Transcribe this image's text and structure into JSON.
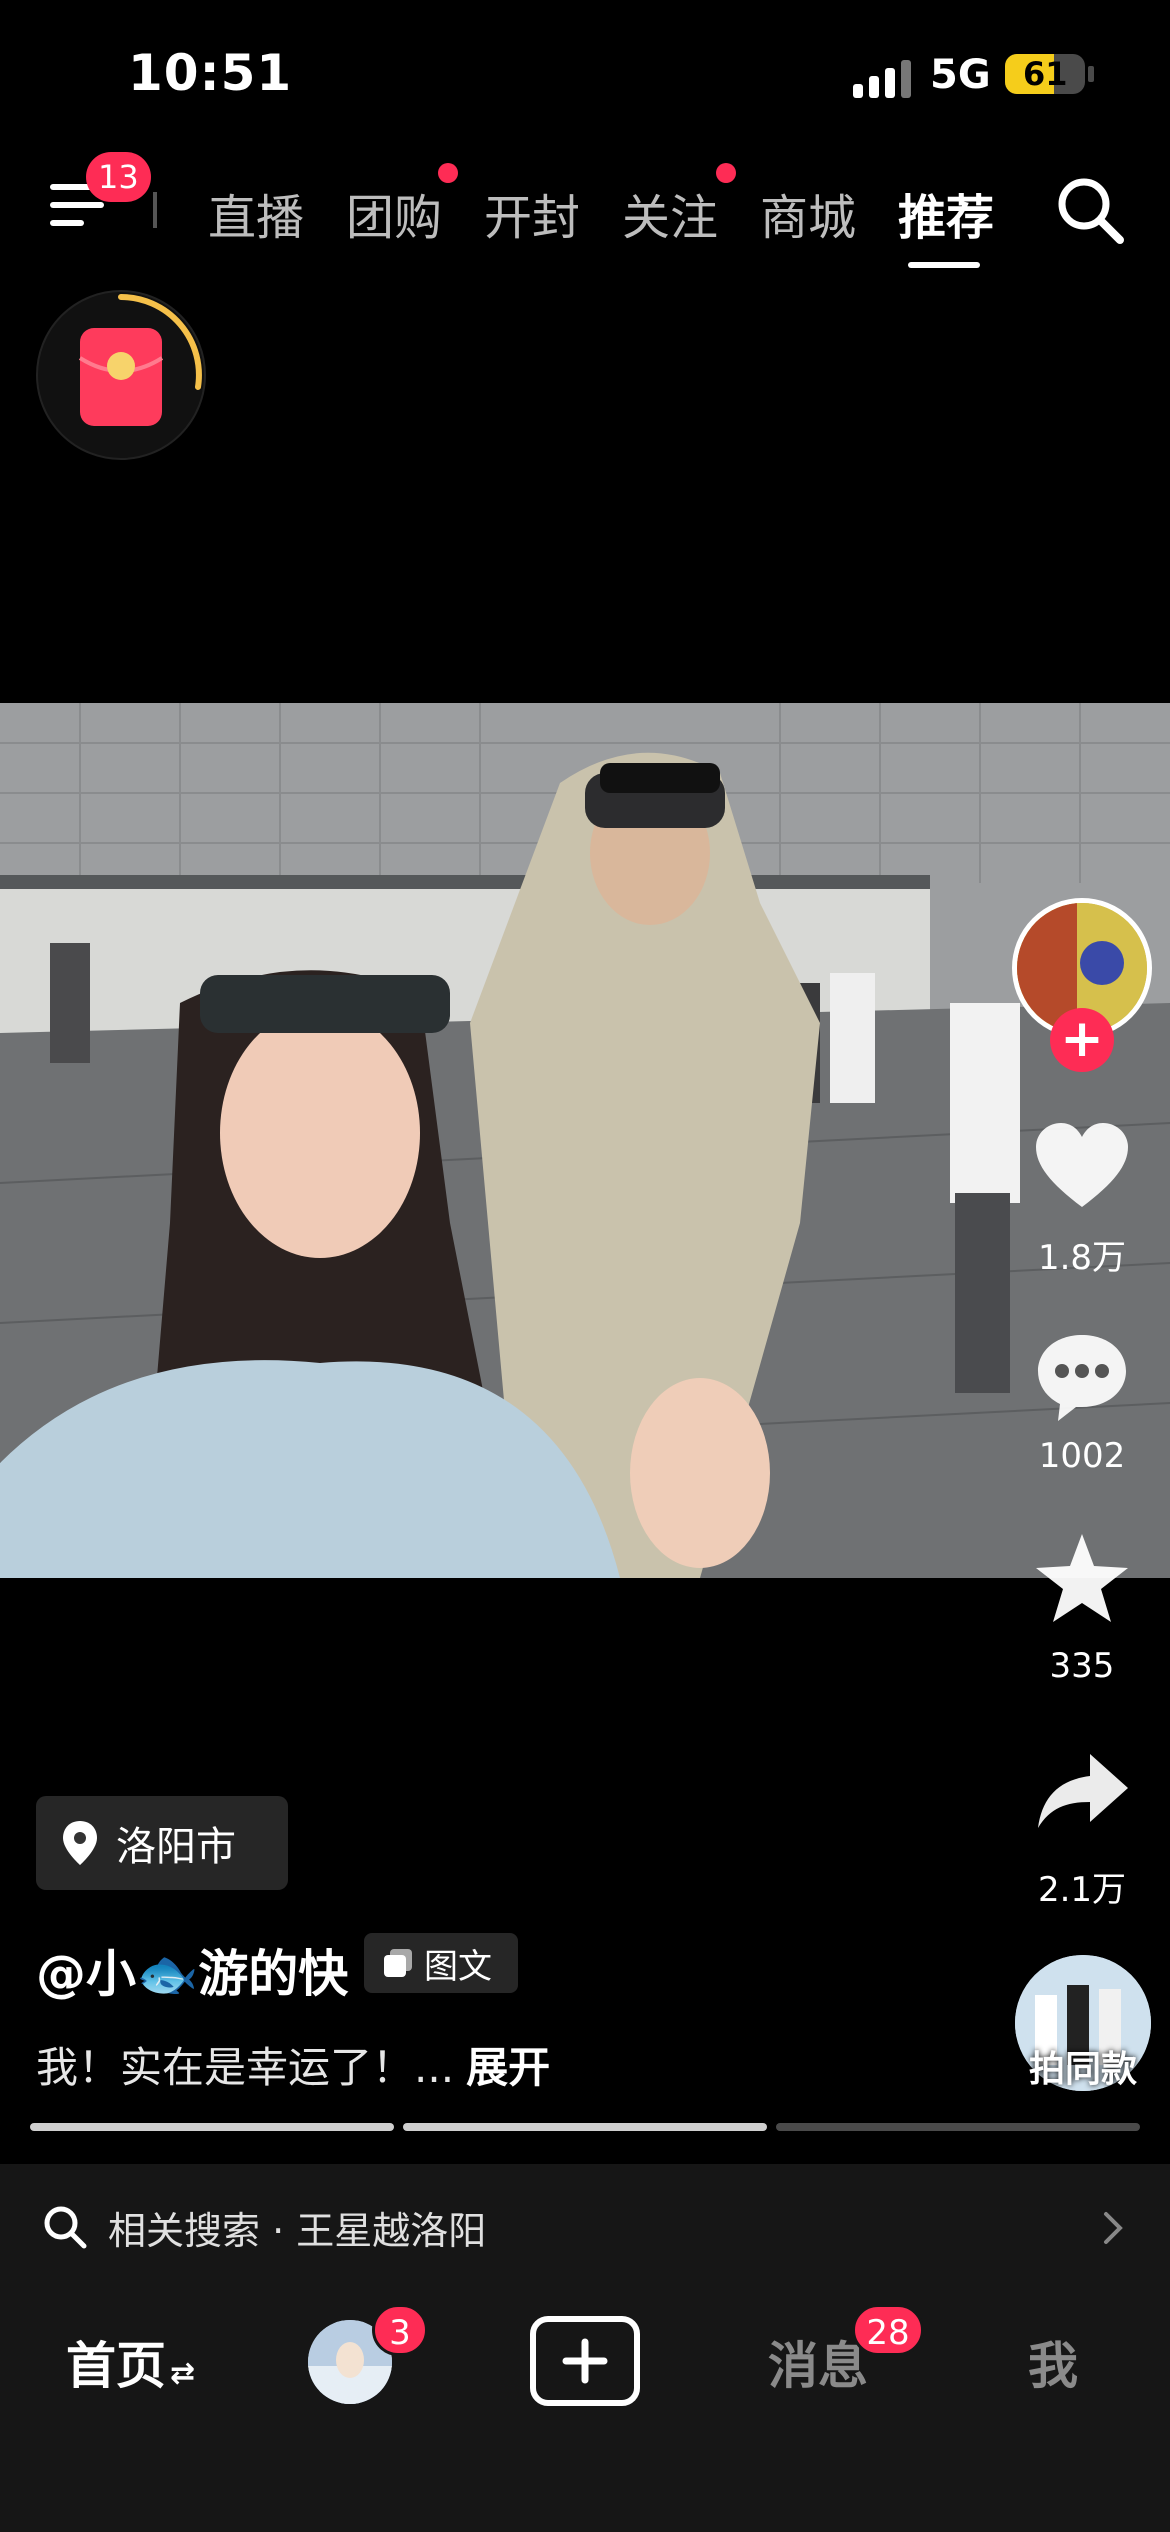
{
  "status_bar": {
    "time": "10:51",
    "network": "5G",
    "battery": "61",
    "battery_level": 0.61
  },
  "top_nav": {
    "menu_badge": "13",
    "tabs": [
      {
        "label": "直播",
        "has_dot": false,
        "active": false
      },
      {
        "label": "团购",
        "has_dot": true,
        "active": false
      },
      {
        "label": "开封",
        "has_dot": false,
        "active": false
      },
      {
        "label": "关注",
        "has_dot": true,
        "active": false
      },
      {
        "label": "商城",
        "has_dot": false,
        "active": false
      },
      {
        "label": "推荐",
        "has_dot": false,
        "active": true
      }
    ]
  },
  "rail": {
    "likes": "1.8万",
    "comments": "1002",
    "favorites": "335",
    "shares": "2.1万",
    "same_style_label": "拍同款"
  },
  "post": {
    "location": "洛阳市",
    "author": "@小🐟游的快",
    "type_tag": "图文",
    "caption": "我！实在是幸运了！...",
    "expand_label": "展开",
    "page_progress": [
      1,
      1,
      0
    ]
  },
  "related_search": {
    "text": "相关搜索 · 王星越洛阳"
  },
  "tab_bar": {
    "home": "首页",
    "home_swap": "⇄",
    "friends_badge": "3",
    "messages": "消息",
    "messages_badge": "28",
    "me": "我"
  },
  "colors": {
    "accent": "#fe2c55",
    "battery": "#f5cd1b",
    "background": "#000000",
    "bar": "#161616"
  },
  "icons": [
    "menu-icon",
    "search-icon",
    "red-packet-icon",
    "heart-icon",
    "comment-icon",
    "star-icon",
    "share-icon",
    "location-pin-icon",
    "image-text-icon",
    "chevron-right-icon",
    "plus-icon"
  ]
}
